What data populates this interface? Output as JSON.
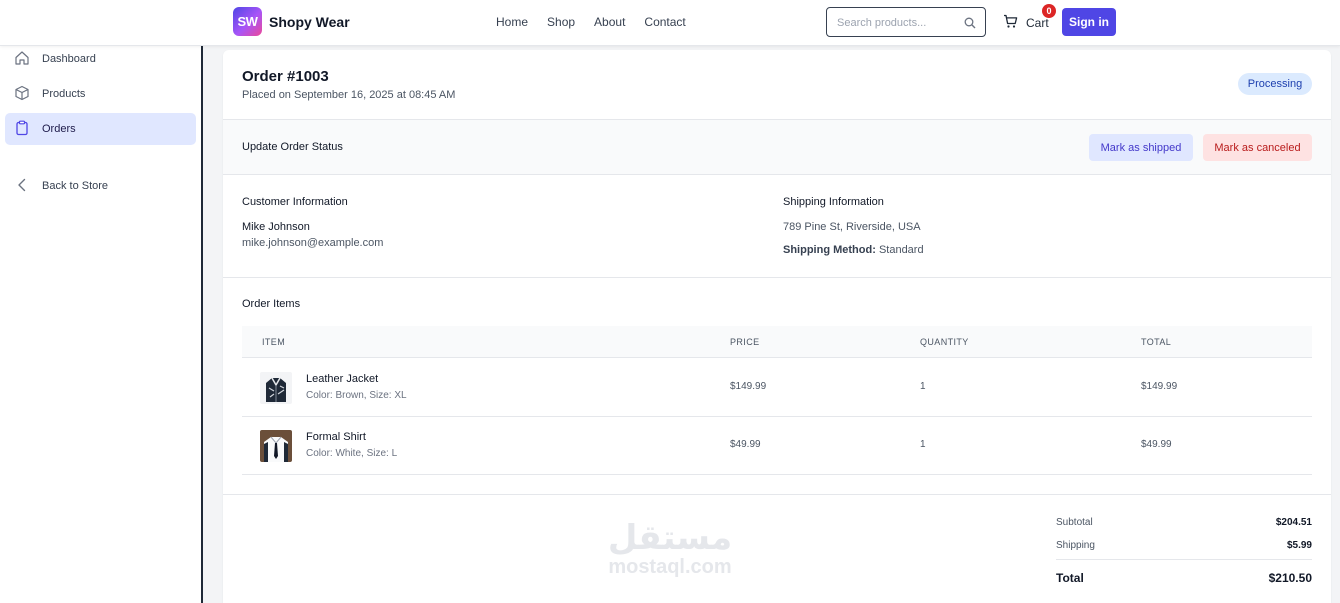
{
  "header": {
    "logo_mark": "SW",
    "brand": "Shopy Wear",
    "nav": [
      "Home",
      "Shop",
      "About",
      "Contact"
    ],
    "search_placeholder": "Search products...",
    "cart_label": "Cart",
    "cart_count": "0",
    "signin_label": "Sign in"
  },
  "sidebar": {
    "items": [
      {
        "label": "Dashboard",
        "icon": "home-icon"
      },
      {
        "label": "Products",
        "icon": "cube-icon"
      },
      {
        "label": "Orders",
        "icon": "clipboard-icon",
        "active": true
      },
      {
        "label": "Back to Store",
        "icon": "chevron-left-icon"
      }
    ]
  },
  "order": {
    "title": "Order #1003",
    "placed": "Placed on September 16, 2025 at 08:45 AM",
    "status": "Processing"
  },
  "status_update": {
    "label": "Update Order Status",
    "ship_btn": "Mark as shipped",
    "cancel_btn": "Mark as canceled"
  },
  "customer": {
    "heading": "Customer Information",
    "name": "Mike Johnson",
    "email": "mike.johnson@example.com"
  },
  "shipping": {
    "heading": "Shipping Information",
    "address": "789 Pine St, Riverside, USA",
    "method_label": "Shipping Method:",
    "method": "Standard"
  },
  "items": {
    "heading": "Order Items",
    "columns": [
      "ITEM",
      "PRICE",
      "QUANTITY",
      "TOTAL"
    ],
    "rows": [
      {
        "name": "Leather Jacket",
        "variant": "Color: Brown, Size: XL",
        "price": "$149.99",
        "qty": "1",
        "total": "$149.99"
      },
      {
        "name": "Formal Shirt",
        "variant": "Color: White, Size: L",
        "price": "$49.99",
        "qty": "1",
        "total": "$49.99"
      }
    ]
  },
  "summary": {
    "subtotal_label": "Subtotal",
    "subtotal": "$204.51",
    "shipping_label": "Shipping",
    "shipping": "$5.99",
    "total_label": "Total",
    "total": "$210.50"
  },
  "watermark": {
    "arabic": "مستقل",
    "latin": "mostaql.com"
  },
  "colors": {
    "accent": "#4f46e5",
    "badge": "#dc2626",
    "status_bg": "#dbeafe",
    "cancel_bg": "#fee2e2"
  }
}
